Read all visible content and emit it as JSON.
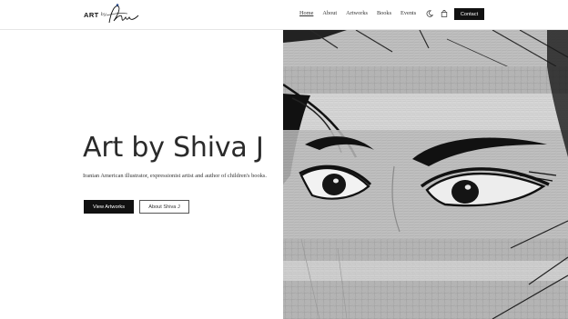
{
  "header": {
    "logo": {
      "text": "ART",
      "by": "by",
      "signature_icon": "signature-icon"
    },
    "nav": [
      {
        "label": "Home",
        "active": true
      },
      {
        "label": "About",
        "active": false
      },
      {
        "label": "Artworks",
        "active": false
      },
      {
        "label": "Books",
        "active": false
      },
      {
        "label": "Events",
        "active": false
      }
    ],
    "icons": {
      "theme": "moon-icon",
      "cart": "bag-icon"
    },
    "contact_label": "Contact"
  },
  "hero": {
    "title": "Art by Shiva J",
    "subtitle": "Iranian American illustrator, expressionist artist and author of children's books.",
    "primary_button": "View Artworks",
    "secondary_button": "About Shiva J"
  },
  "artwork": {
    "subject": "artwork-painting",
    "colors": {
      "silver": "#bdbdbd",
      "black": "#111111",
      "light": "#e5e5e5"
    }
  }
}
